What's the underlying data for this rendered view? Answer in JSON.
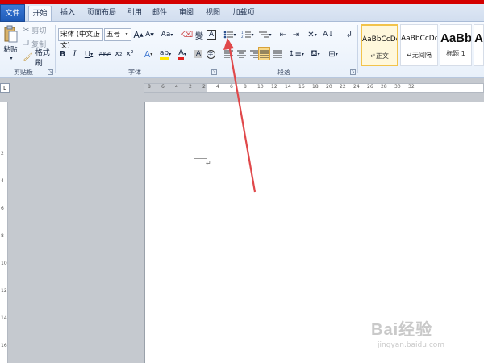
{
  "tabs": {
    "file": "文件",
    "home": "开始",
    "insert": "插入",
    "layout": "页面布局",
    "references": "引用",
    "mailings": "邮件",
    "review": "审阅",
    "view": "视图",
    "addins": "加载项"
  },
  "clipboard": {
    "paste": "粘贴",
    "cut": "剪切",
    "copy": "复制",
    "format_painter": "格式刷",
    "group_label": "剪贴板"
  },
  "font": {
    "font_name": "宋体 (中文正文)",
    "font_size": "五号",
    "group_label": "字体",
    "bold": "B",
    "italic": "I",
    "underline": "U",
    "strike": "abc",
    "subscript": "x₂",
    "superscript": "x²",
    "change_case": "Aa",
    "grow": "A",
    "shrink": "A",
    "phonetic": "變",
    "char_border": "A"
  },
  "paragraph": {
    "group_label": "段落"
  },
  "styles": {
    "items": [
      {
        "sample": "AaBbCcDd",
        "name": "正文"
      },
      {
        "sample": "AaBbCcDd",
        "name": "无间隔"
      },
      {
        "sample": "AaBb",
        "name": "标题 1"
      },
      {
        "sample": "A",
        "name": ""
      }
    ]
  },
  "ruler": {
    "h_numbers": [
      "8",
      "6",
      "4",
      "2",
      "2",
      "4",
      "6",
      "8",
      "10",
      "12",
      "14",
      "16",
      "18",
      "20",
      "22",
      "24",
      "26",
      "28",
      "30",
      "32"
    ],
    "v_numbers": [
      "2",
      "4",
      "6",
      "8",
      "10",
      "12",
      "14",
      "16"
    ],
    "corner": "L"
  },
  "document": {
    "paragraph_mark": "↵"
  },
  "watermark": {
    "main": "Bai经验",
    "sub": "jingyan.baidu.com"
  },
  "colors": {
    "accent_red": "#d40000",
    "file_tab": "#2a66c4",
    "highlight_yellow": "#f2c34b"
  }
}
